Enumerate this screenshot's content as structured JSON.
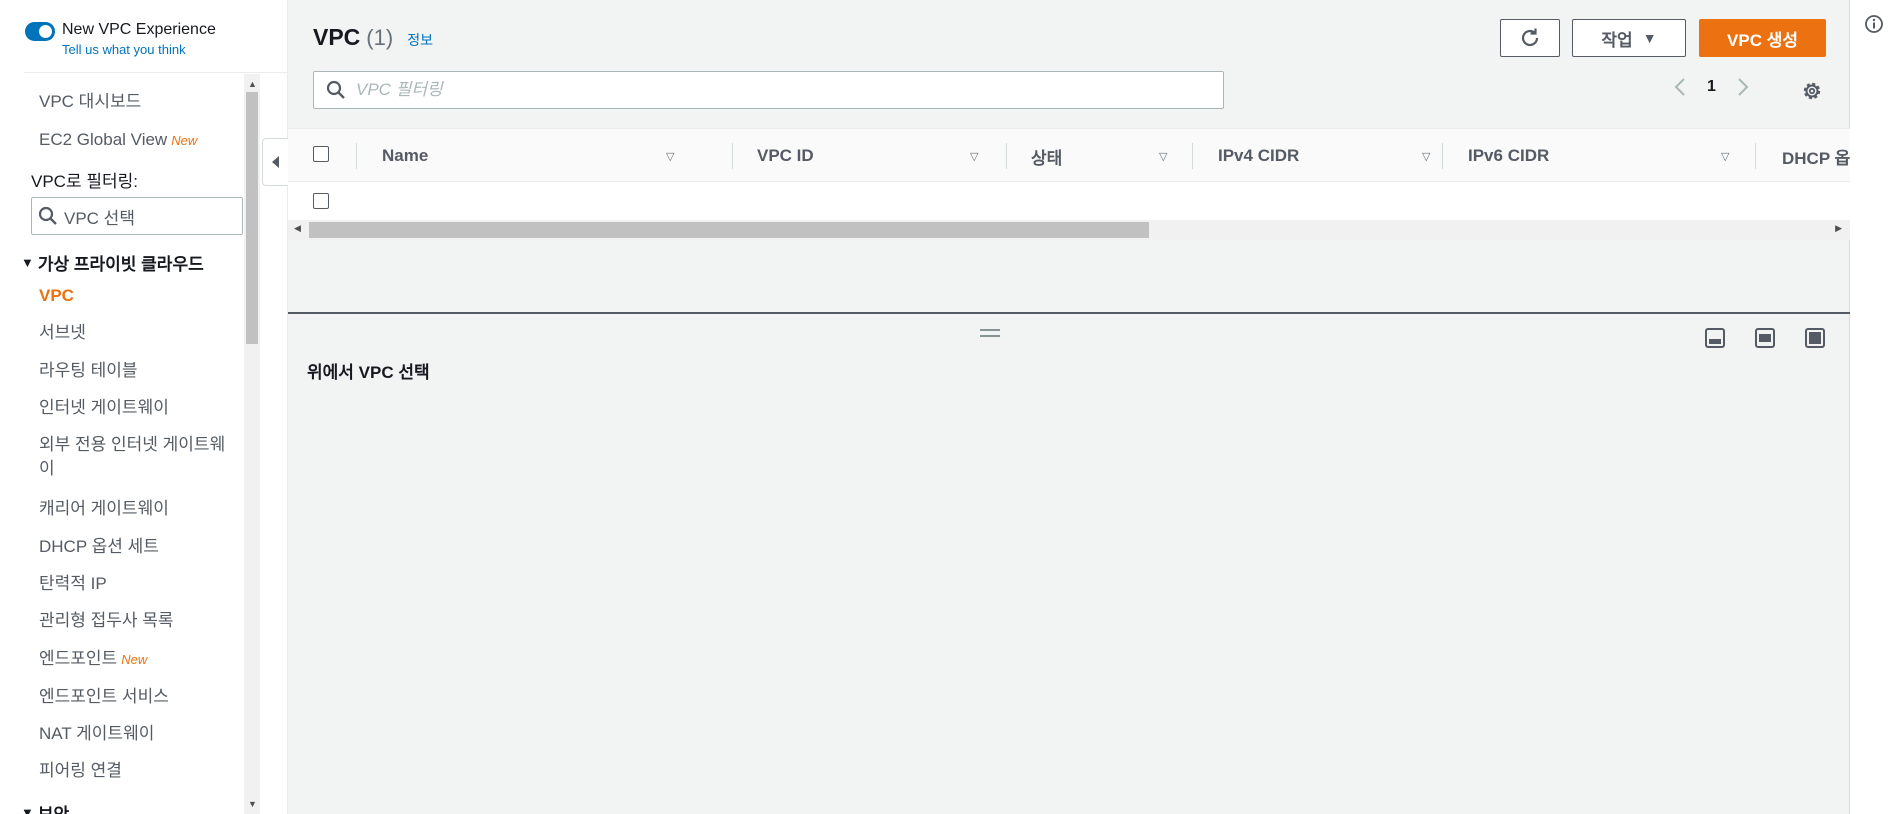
{
  "sidebar": {
    "toggle_label": "New VPC Experience",
    "feedback_link": "Tell us what you think",
    "dashboard": "VPC 대시보드",
    "ec2_global_view": "EC2 Global View",
    "new_badge": "New",
    "filter_label": "VPC로 필터링:",
    "filter_placeholder": "VPC 선택",
    "section_title": "가상 프라이빗 클라우드",
    "items": [
      {
        "label": "VPC"
      },
      {
        "label": "서브넷"
      },
      {
        "label": "라우팅 테이블"
      },
      {
        "label": "인터넷 게이트웨이"
      },
      {
        "label": "외부 전용 인터넷 게이트웨이"
      },
      {
        "label": "캐리어 게이트웨이"
      },
      {
        "label": "DHCP 옵션 세트"
      },
      {
        "label": "탄력적 IP"
      },
      {
        "label": "관리형 접두사 목록"
      },
      {
        "label": "엔드포인트"
      },
      {
        "label": "엔드포인트 서비스"
      },
      {
        "label": "NAT 게이트웨이"
      },
      {
        "label": "피어링 연결"
      }
    ],
    "next_section": "보안"
  },
  "header": {
    "title": "VPC",
    "count": "(1)",
    "info_link": "정보",
    "actions_label": "작업",
    "create_label": "VPC 생성"
  },
  "filter": {
    "placeholder": "VPC 필터링"
  },
  "pagination": {
    "page": "1"
  },
  "table": {
    "columns": [
      "Name",
      "VPC ID",
      "상태",
      "IPv4 CIDR",
      "IPv6 CIDR",
      "DHCP 옵"
    ]
  },
  "details": {
    "empty_message": "위에서 VPC 선택"
  },
  "colors": {
    "accent": "#ec7211",
    "link": "#0073bb"
  }
}
